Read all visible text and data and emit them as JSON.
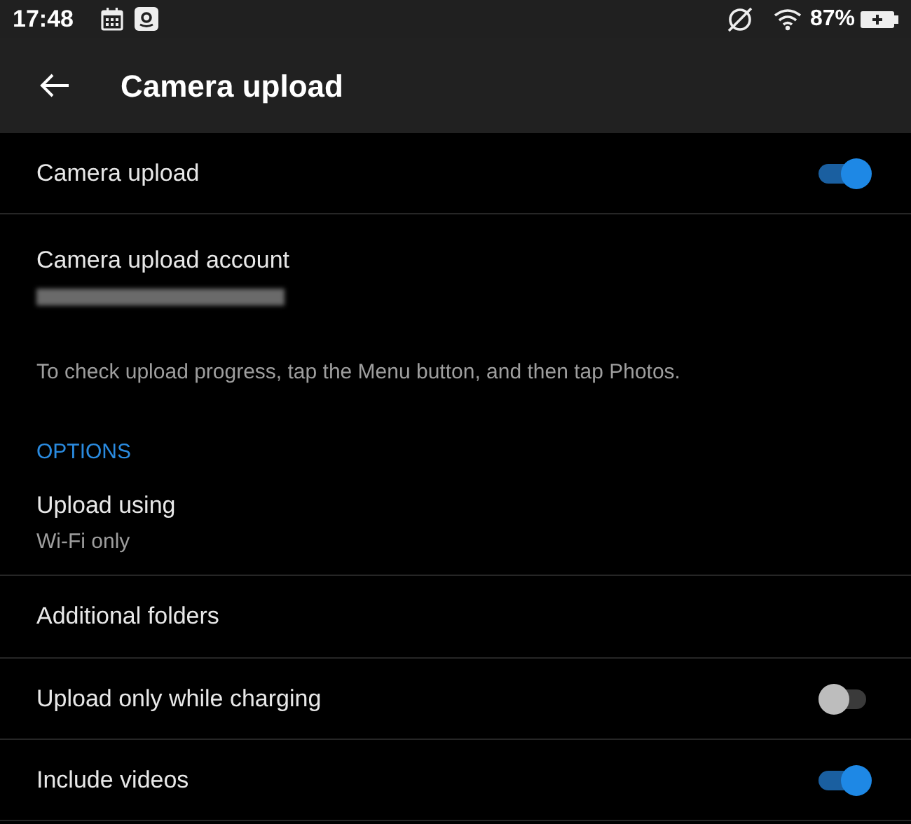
{
  "status_bar": {
    "time": "17:48",
    "battery": "87%"
  },
  "header": {
    "title": "Camera upload"
  },
  "items": [
    {
      "kind": "toggle",
      "label": "Camera upload",
      "on": true
    },
    {
      "kind": "account",
      "label": "Camera upload account",
      "redacted": true
    },
    {
      "kind": "info",
      "text": "To check upload progress, tap the Menu button, and then tap Photos."
    },
    {
      "kind": "section",
      "text": "OPTIONS"
    },
    {
      "kind": "detail",
      "label": "Upload using",
      "value": "Wi-Fi only"
    },
    {
      "kind": "nav",
      "label": "Additional folders"
    },
    {
      "kind": "toggle",
      "label": "Upload only while charging",
      "on": false
    },
    {
      "kind": "toggle",
      "label": "Include videos",
      "on": true
    }
  ]
}
